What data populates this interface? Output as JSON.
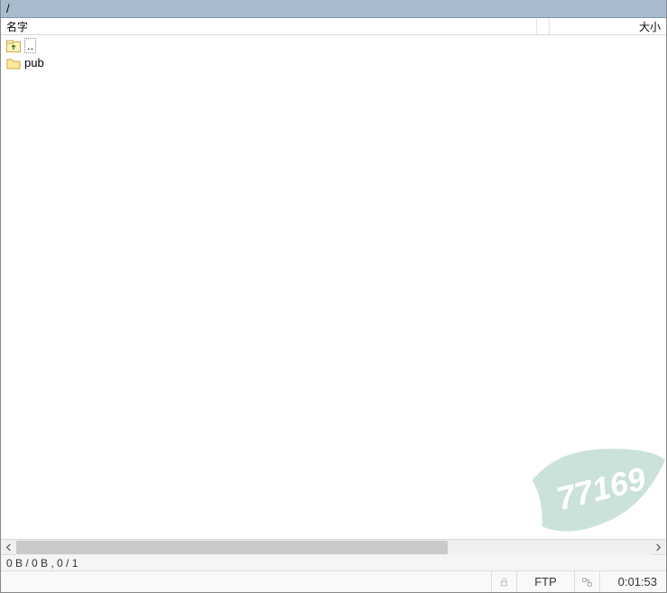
{
  "pathbar": {
    "path": "/"
  },
  "columns": {
    "name": "名字",
    "size": "大小"
  },
  "rows": [
    {
      "kind": "up",
      "label": ".."
    },
    {
      "kind": "folder",
      "label": "pub"
    }
  ],
  "status": {
    "summary": "0 B / 0 B ,  0 / 1"
  },
  "footer": {
    "protocol": "FTP",
    "elapsed": "0:01:53"
  },
  "watermark": {
    "text": "77169"
  }
}
